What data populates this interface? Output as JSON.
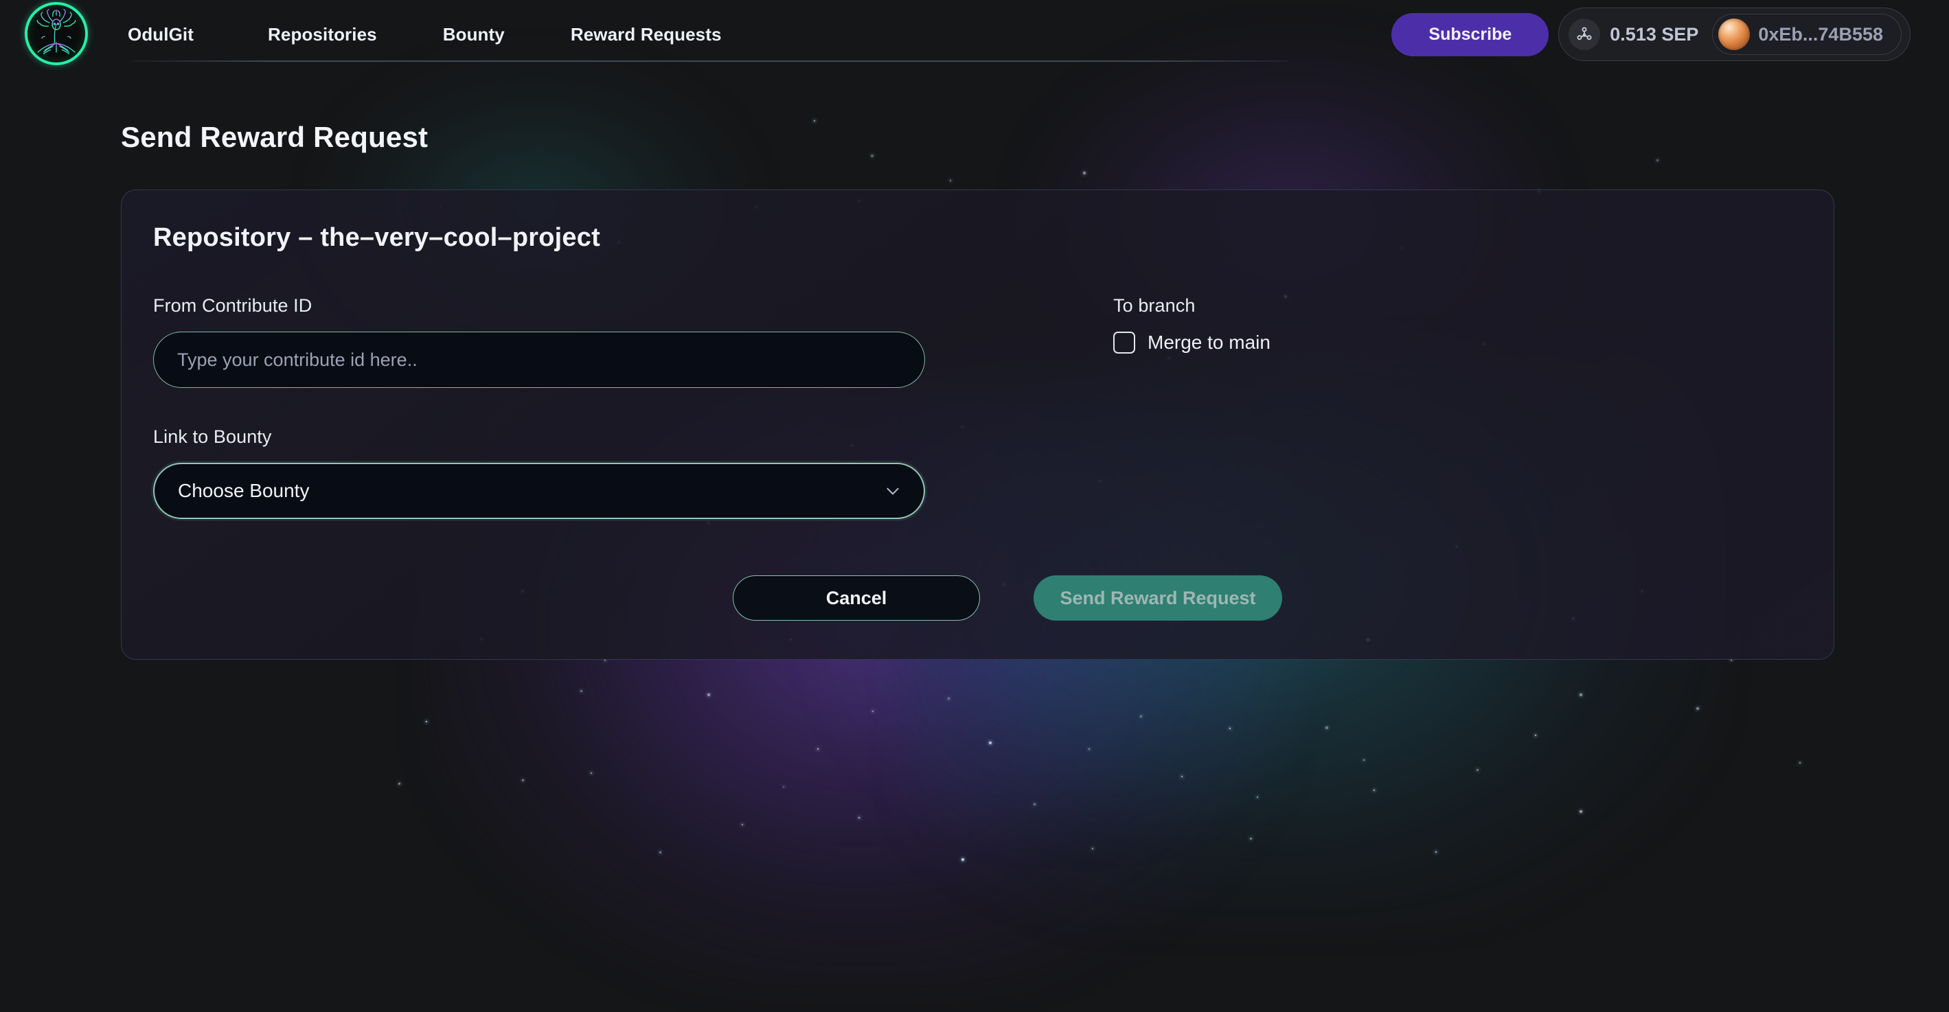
{
  "header": {
    "logo_alt": "odulgit-logo",
    "nav": [
      {
        "label": "OdulGit"
      },
      {
        "label": "Repositories"
      },
      {
        "label": "Bounty"
      },
      {
        "label": "Reward Requests"
      }
    ],
    "subscribe_label": "Subscribe",
    "balance": "0.513 SEP",
    "wallet_address": "0xEb...74B558"
  },
  "main": {
    "page_title": "Send Reward Request",
    "card_title": "Repository – the–very–cool–project",
    "fields": {
      "contribute_id": {
        "label": "From Contribute ID",
        "placeholder": "Type your contribute id here..",
        "value": ""
      },
      "bounty": {
        "label": "Link to Bounty",
        "selected": "Choose Bounty"
      },
      "branch": {
        "label": "To branch",
        "checkbox_label": "Merge to main",
        "checked": false
      }
    },
    "actions": {
      "cancel_label": "Cancel",
      "submit_label": "Send Reward Request"
    }
  },
  "colors": {
    "page_bg": "#151618",
    "accent_purple": "#4c2fa8",
    "accent_teal": "#2f7f72",
    "input_border": "#7fb9a6",
    "logo_ring": "#25f0a8",
    "card_border": "#566280",
    "text_primary": "#f2f4f9",
    "text_muted": "#9da0b4"
  }
}
